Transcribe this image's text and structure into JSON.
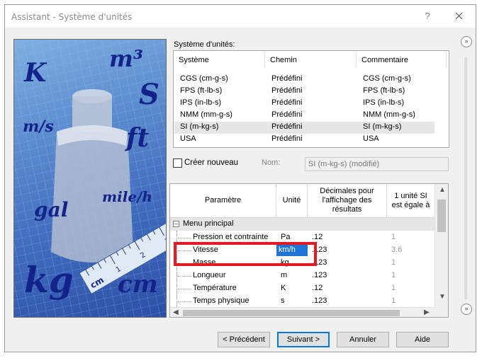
{
  "window": {
    "title": "Assistant - Système d'unités",
    "help_label": "?"
  },
  "image_panel": {
    "units": [
      "K",
      "m³",
      "S",
      "m/s",
      "ft",
      "gal",
      "mile/h",
      "kg",
      "cm"
    ],
    "ruler_labels": [
      "1",
      "2",
      "3",
      "cm"
    ]
  },
  "unit_systems": {
    "section_label": "Système d'unités:",
    "columns": [
      "Système",
      "Chemin",
      "Commentaire"
    ],
    "rows": [
      [
        "CGS (cm-g-s)",
        "Prédéfini",
        "CGS (cm-g-s)"
      ],
      [
        "FPS (ft-lb-s)",
        "Prédéfini",
        "FPS (ft-lb-s)"
      ],
      [
        "IPS (in-lb-s)",
        "Prédéfini",
        "IPS (in-lb-s)"
      ],
      [
        "NMM (mm-g-s)",
        "Prédéfini",
        "NMM (mm-g-s)"
      ],
      [
        "SI (m-kg-s)",
        "Prédéfini",
        "SI (m-kg-s)"
      ],
      [
        "USA",
        "Prédéfini",
        "USA"
      ]
    ],
    "selected_index": 4
  },
  "create_new": {
    "label": "Créer nouveau",
    "checked": false,
    "name_label": "Nom:",
    "name_value": "SI (m-kg-s) (modifié)"
  },
  "param_grid": {
    "columns": [
      "Paramètre",
      "Unité",
      "Décimales pour l'affichage des résultats",
      "1 unité SI est égale à"
    ],
    "group": "Menu principal",
    "rows": [
      [
        "Pression et contrainte",
        "Pa",
        ".12",
        "1"
      ],
      [
        "Vitesse",
        "km/h",
        ".123",
        "3.6"
      ],
      [
        "Masse",
        "kg",
        ".123",
        "1"
      ],
      [
        "Longueur",
        "m",
        ".123",
        "1"
      ],
      [
        "Température",
        "K",
        ".12",
        "1"
      ],
      [
        "Temps physique",
        "s",
        ".123",
        "1"
      ]
    ],
    "editing_row": 1
  },
  "buttons": {
    "previous": "< Précédent",
    "next": "Suivant >",
    "cancel": "Annuler",
    "help": "Aide"
  },
  "colors": {
    "highlight": "#e01b24",
    "selection": "#1f74d6"
  }
}
